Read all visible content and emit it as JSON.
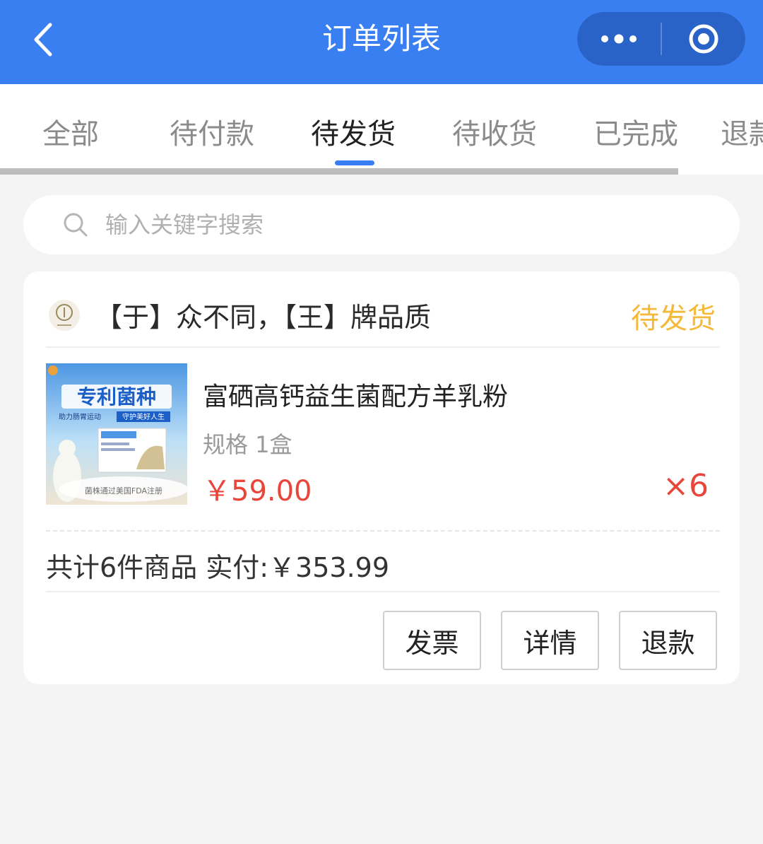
{
  "header": {
    "title": "订单列表"
  },
  "tabs": [
    {
      "label": "全部"
    },
    {
      "label": "待付款"
    },
    {
      "label": "待发货"
    },
    {
      "label": "待收货"
    },
    {
      "label": "已完成"
    },
    {
      "label": "退款"
    }
  ],
  "active_tab": "待发货",
  "search": {
    "placeholder": "输入关键字搜索"
  },
  "order": {
    "shop_name": "【于】众不同，【王】牌品质",
    "status": "待发货",
    "product": {
      "name": "富硒高钙益生菌配方羊乳粉",
      "spec": "规格 1盒",
      "price": "￥59.00",
      "quantity": "×6",
      "image_text": {
        "headline": "专利菌种",
        "tagline_left": "助力肠胃运动",
        "tagline_right": "守护美好人生",
        "footer": "菌株通过美国FDA注册"
      }
    },
    "summary": "共计6件商品 实付:￥353.99",
    "actions": {
      "invoice": "发票",
      "detail": "详情",
      "refund": "退款"
    }
  },
  "colors": {
    "header_bg": "#3a7ff2",
    "capsule_bg": "#2a63c8",
    "accent": "#3a7ff2",
    "status": "#f5b93a",
    "price": "#e8463a"
  },
  "icons": {
    "back": "chevron-left-icon",
    "more": "more-dots-icon",
    "close": "target-circle-icon",
    "search": "search-icon"
  }
}
